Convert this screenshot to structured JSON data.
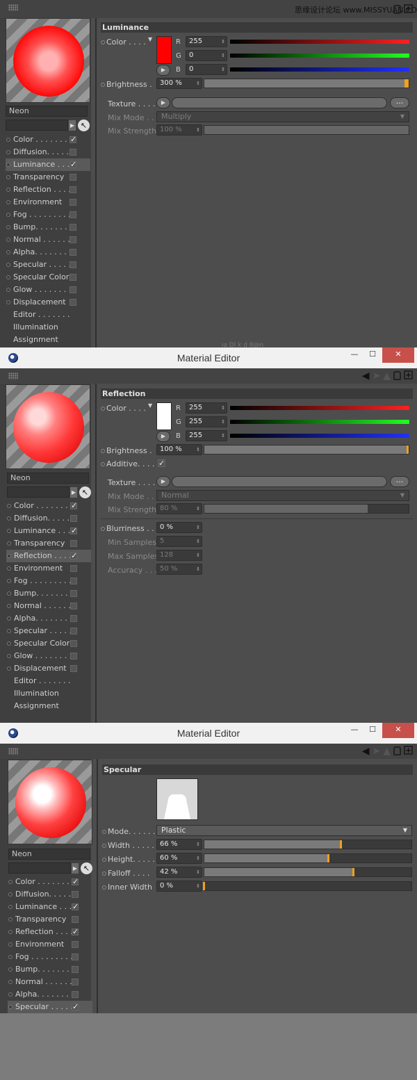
{
  "watermark": "思缘设计论坛 www.MISSYUAN.COM",
  "window_title": "Material Editor",
  "material_name": "Neon",
  "channels_top": [
    {
      "label": "Color . . . . . . . .",
      "checked": true
    },
    {
      "label": "Diffusion. . . . .",
      "checked": false
    },
    {
      "label": "Luminance . . .",
      "checked": true
    },
    {
      "label": "Transparency",
      "checked": false
    },
    {
      "label": "Reflection . . . .",
      "checked": false
    },
    {
      "label": "Environment",
      "checked": false
    },
    {
      "label": "Fog . . . . . . . . .",
      "checked": false
    },
    {
      "label": "Bump. . . . . . . .",
      "checked": false
    },
    {
      "label": "Normal . . . . . .",
      "checked": false
    },
    {
      "label": "Alpha. . . . . . . .",
      "checked": false
    },
    {
      "label": "Specular . . . . .",
      "checked": false
    },
    {
      "label": "Specular Color",
      "checked": false
    },
    {
      "label": "Glow . . . . . . . .",
      "checked": false
    },
    {
      "label": "Displacement",
      "checked": false
    }
  ],
  "channels_extra": [
    "Editor . . . . . . .",
    "Illumination",
    "Assignment"
  ],
  "panel1": {
    "section": "Luminance",
    "color_label": "Color . . . .",
    "r": "255",
    "g": "0",
    "b": "0",
    "r_label": "R",
    "g_label": "G",
    "b_label": "B",
    "brightness_label": "Brightness .",
    "brightness": "300 %",
    "texture_label": "Texture . . . .",
    "mixmode_label": "Mix Mode . .",
    "mixmode": "Multiply",
    "mixstrength_label": "Mix Strength",
    "mixstrength": "100 %",
    "dots": "...",
    "bottom_fragment": "ıa Dl k d 8@n"
  },
  "panel2": {
    "section": "Reflection",
    "color_label": "Color . . . .",
    "r": "255",
    "g": "255",
    "b": "255",
    "brightness_label": "Brightness .",
    "brightness": "100 %",
    "additive_label": "Additive. . . .",
    "texture_label": "Texture . . . .",
    "mixmode_label": "Mix Mode . .",
    "mixmode": "Normal",
    "mixstrength_label": "Mix Strength",
    "mixstrength": "80 %",
    "blurriness_label": "Blurriness . .",
    "blurriness": "0 %",
    "minsamples_label": "Min Samples",
    "minsamples": "5",
    "maxsamples_label": "Max Samples",
    "maxsamples": "128",
    "accuracy_label": "Accuracy . . .",
    "accuracy": "50 %"
  },
  "panel3": {
    "section": "Specular",
    "mode_label": "Mode. . . . . .",
    "mode": "Plastic",
    "width_label": "Width . . . . .",
    "width": "66 %",
    "height_label": "Height. . . . .",
    "height": "60 %",
    "falloff_label": "Falloff . . . .",
    "falloff": "42 %",
    "innerwidth_label": "Inner Width",
    "innerwidth": "0 %",
    "partial_channel": "Specular C"
  },
  "levels": {
    "p1_brightness": 1.0,
    "p2_brightness": 1.0,
    "p2_mixstrength": 0.8,
    "p3_width": 0.66,
    "p3_height": 0.6,
    "p3_falloff": 0.72,
    "p3_innerwidth": 0.0
  },
  "colors": {
    "accent": "#f0a020",
    "luminance_swatch": "#ff0000",
    "reflection_swatch": "#ffffff",
    "close": "#c7504b"
  },
  "icons": [
    "grid-handle-icon",
    "arrow-left-icon",
    "lock-icon",
    "new-window-icon",
    "eyedropper-icon",
    "app-icon",
    "close-icon",
    "maximize-icon",
    "minimize-icon"
  ]
}
